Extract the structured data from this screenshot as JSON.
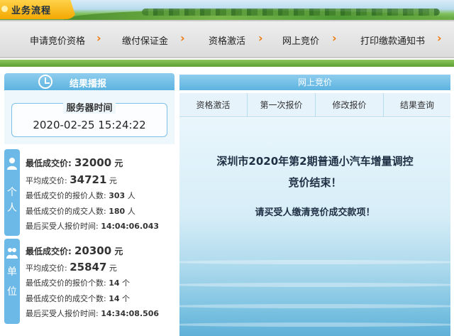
{
  "header": {
    "section_title": "业务流程"
  },
  "process_steps": [
    {
      "label": "申请竞价资格"
    },
    {
      "label": "缴付保证金"
    },
    {
      "label": "资格激活"
    },
    {
      "label": "网上竞价"
    },
    {
      "label": "打印缴款通知书"
    }
  ],
  "left_panel": {
    "title": "结果播报",
    "server_time_label": "服务器时间",
    "server_time": "2020-02-25 15:24:22",
    "personal": {
      "side_label": [
        "个",
        "人"
      ],
      "lowest_price_label": "最低成交价:",
      "lowest_price": "32000",
      "avg_price_label": "平均成交价:",
      "avg_price": "34721",
      "bidders_at_lowest_label": "最低成交价的报价人数:",
      "bidders_at_lowest": "303",
      "winners_at_lowest_label": "最低成交价的成交人数:",
      "winners_at_lowest": "180",
      "last_time_label": "最后买受人报价时间:",
      "last_time": "14:04:06.043",
      "unit_yuan": "元",
      "unit_people": "人"
    },
    "company": {
      "side_label": [
        "单",
        "位"
      ],
      "lowest_price_label": "最低成交价:",
      "lowest_price": "20300",
      "avg_price_label": "平均成交价:",
      "avg_price": "25847",
      "bidders_at_lowest_label": "最低成交价的报价个数:",
      "bidders_at_lowest": "14",
      "winners_at_lowest_label": "最低成交价的成交个数:",
      "winners_at_lowest": "14",
      "last_time_label": "最后买受人报价时间:",
      "last_time": "14:34:08.506",
      "unit_yuan": "元",
      "unit_count": "个"
    }
  },
  "right_panel": {
    "title": "网上竞价",
    "tabs": [
      {
        "label": "资格激活"
      },
      {
        "label": "第一次报价"
      },
      {
        "label": "修改报价"
      },
      {
        "label": "结果查询"
      }
    ],
    "message_line1": "深圳市2020年第2期普通小汽车增量调控",
    "message_line2": "竞价结束！",
    "message_line3": "请买受人缴清竞价成交款项！"
  },
  "colors": {
    "accent_orange": "#ee7a0e",
    "panel_blue": "#5cb3e0",
    "tag_yellow": "#f3a800"
  }
}
